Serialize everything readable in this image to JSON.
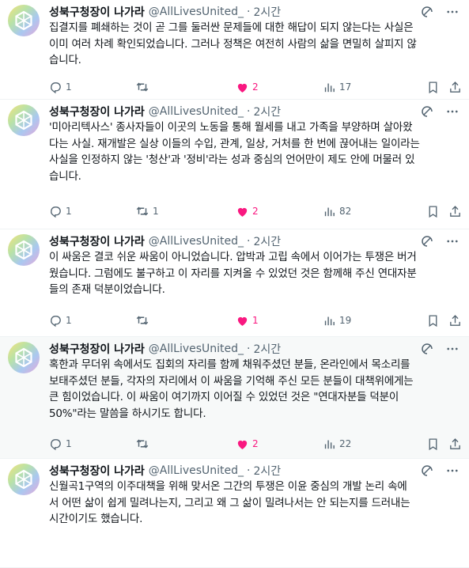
{
  "colors": {
    "like": "#f91880",
    "muted": "#536471",
    "text": "#0f1419",
    "highlight_bg": "#f7f9f9"
  },
  "icons": {
    "grok": "grok-icon",
    "more": "more-icon",
    "reply": "reply-icon",
    "retweet": "retweet-icon",
    "like": "heart-icon",
    "views": "views-icon",
    "bookmark": "bookmark-icon",
    "share": "share-icon"
  },
  "tweets": [
    {
      "name": "성북구청장이 나가라",
      "handle": "@AllLivesUnited_",
      "dot": "·",
      "time": "2시간",
      "text": "집결지를 폐쇄하는 것이 곧 그를 둘러싼 문제들에 대한 해답이 되지 않는다는 사실은\n이미 여러 차례 확인되었습니다. 그러나 정책은 여전히 사람의 삶을 면밀히 살피지 않\n습니다.",
      "replies": "1",
      "retweets": "",
      "likes": "2",
      "views": "17",
      "liked": true
    },
    {
      "name": "성북구청장이 나가라",
      "handle": "@AllLivesUnited_",
      "dot": "·",
      "time": "2시간",
      "text": "'미아리텍사스' 종사자들이 이곳의 노동을 통해 월세를 내고 가족을 부양하며 살아왔\n다는 사실. 재개발은 실상 이들의 수입, 관계, 일상, 거처를 한 번에 끊어내는 일이라는\n사실을 인정하지 않는 '청산'과 '정비'라는 성과 중심의 언어만이 제도 안에 머물러 있\n습니다.",
      "replies": "1",
      "retweets": "1",
      "likes": "2",
      "views": "82",
      "liked": true
    },
    {
      "name": "성북구청장이 나가라",
      "handle": "@AllLivesUnited_",
      "dot": "·",
      "time": "2시간",
      "text": "이 싸움은 결코 쉬운 싸움이 아니었습니다. 압박과 고립 속에서 이어가는 투쟁은 버거\n웠습니다. 그럼에도 불구하고 이 자리를 지켜올 수 있었던 것은 함께해 주신 연대자분\n들의 존재 덕분이었습니다.",
      "replies": "1",
      "retweets": "",
      "likes": "1",
      "views": "19",
      "liked": true
    },
    {
      "name": "성북구청장이 나가라",
      "handle": "@AllLivesUnited_",
      "dot": "·",
      "time": "2시간",
      "text": "혹한과 무더위 속에서도 집회의 자리를 함께 채워주셨던 분들, 온라인에서 목소리를\n보태주셨던 분들, 각자의 자리에서 이 싸움을 기억해 주신 모든 분들이 대책위에게는\n큰 힘이었습니다. 이 싸움이 여기까지 이어질 수 있었던 것은 \"연대자분들 덕분이\n50%\"라는 말씀을 하시기도 합니다.",
      "replies": "1",
      "retweets": "",
      "likes": "2",
      "views": "22",
      "liked": true
    },
    {
      "name": "성북구청장이 나가라",
      "handle": "@AllLivesUnited_",
      "dot": "·",
      "time": "2시간",
      "text": "신월곡1구역의 이주대책을 위해 맞서온 그간의 투쟁은 이윤 중심의 개발 논리 속에\n서 어떤 삶이 쉽게 밀려나는지, 그리고 왜 그 삶이 밀려나서는 안 되는지를 드러내는\n시간이기도 했습니다.",
      "replies": "1",
      "retweets": "",
      "likes": "",
      "views": "79",
      "liked": false
    }
  ]
}
